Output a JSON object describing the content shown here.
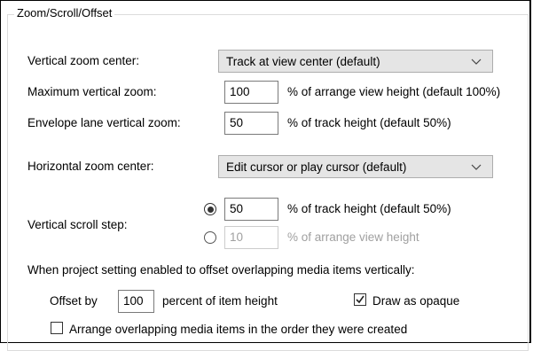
{
  "group": {
    "title": "Zoom/Scroll/Offset"
  },
  "vertical_zoom_center": {
    "label": "Vertical zoom center:",
    "value": "Track at view center (default)"
  },
  "max_vertical_zoom": {
    "label": "Maximum vertical zoom:",
    "value": "100",
    "suffix": "% of arrange view height (default 100%)"
  },
  "envelope_lane_zoom": {
    "label": "Envelope lane vertical zoom:",
    "value": "50",
    "suffix": "% of track height (default 50%)"
  },
  "horizontal_zoom_center": {
    "label": "Horizontal zoom center:",
    "value": "Edit cursor or play cursor (default)"
  },
  "vertical_scroll_step": {
    "label": "Vertical scroll step:",
    "option1": {
      "value": "50",
      "suffix": "% of track height (default 50%)",
      "selected": true
    },
    "option2": {
      "value": "10",
      "suffix": "% of arrange view height",
      "selected": false
    }
  },
  "offset_section": {
    "heading": "When project setting enabled to offset overlapping media items vertically:",
    "offset_by_label": "Offset by",
    "offset_value": "100",
    "offset_suffix": "percent of item height",
    "draw_opaque_label": "Draw as opaque",
    "draw_opaque_checked": true,
    "arrange_order_label": "Arrange overlapping media items in the order they were created",
    "arrange_order_checked": false
  }
}
